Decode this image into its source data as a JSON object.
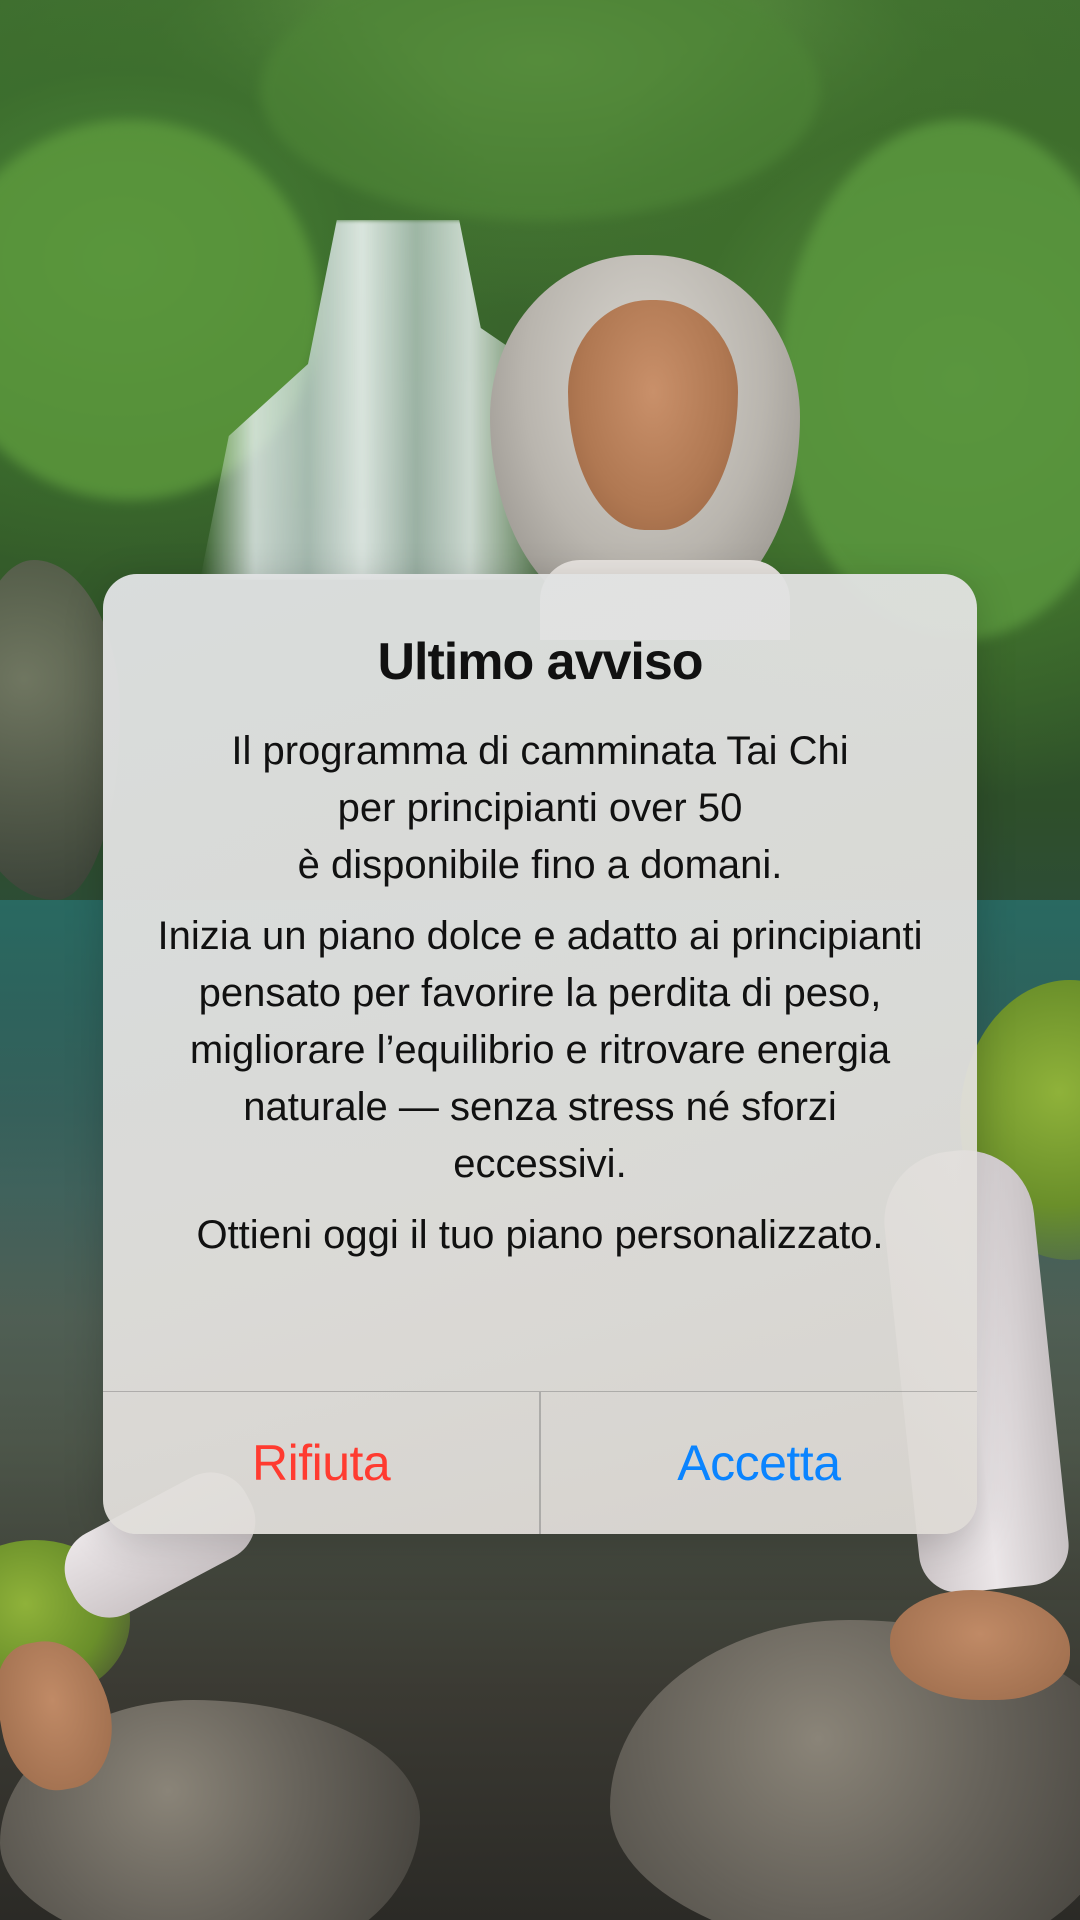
{
  "alert": {
    "title": "Ultimo avviso",
    "paragraphs": [
      "Il programma di camminata Tai Chi\nper principianti over 50\nè disponibile fino a domani.",
      "Inizia un piano dolce e adatto ai principianti\npensato per favorire la perdita di peso, migliorare l’equilibrio e ritrovare energia naturale — senza stress né sforzi eccessivi.",
      "Ottieni oggi il tuo piano personalizzato."
    ],
    "buttons": {
      "reject_label": "Rifiuta",
      "accept_label": "Accetta"
    }
  },
  "colors": {
    "reject": "#ff3b30",
    "accept": "#0a84ff"
  }
}
